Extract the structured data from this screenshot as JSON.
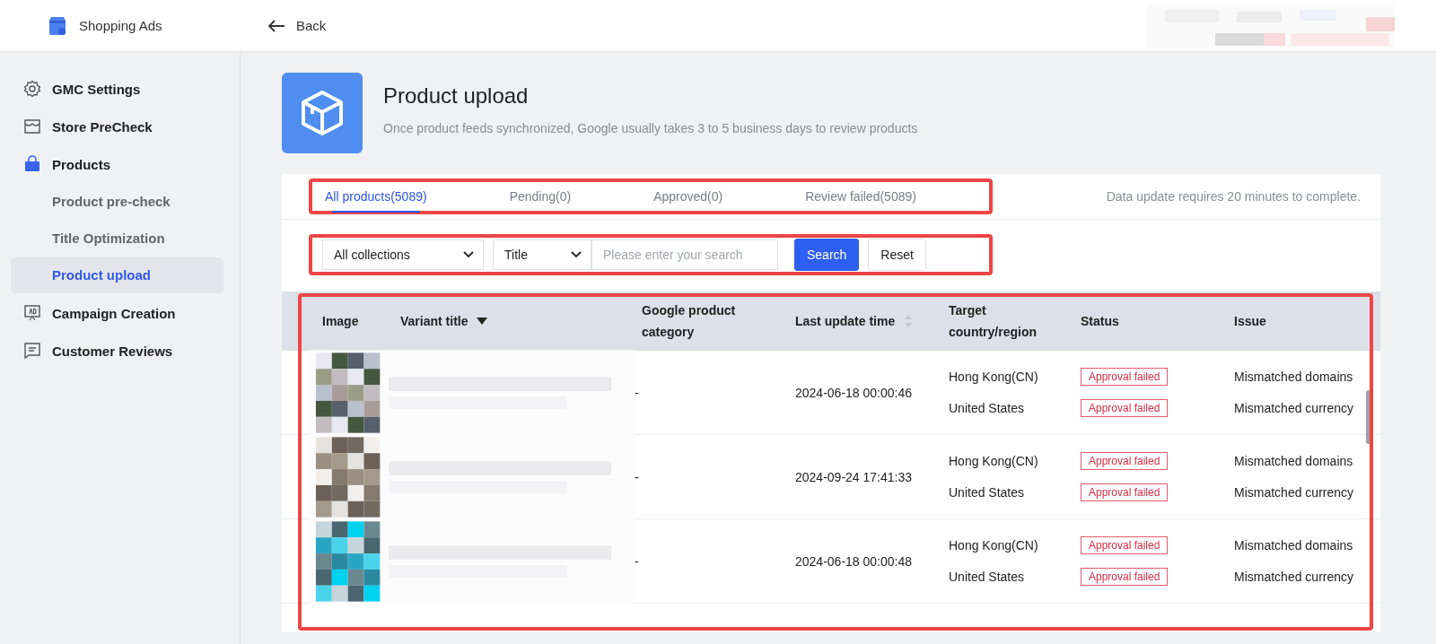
{
  "header": {
    "app_name": "Shopping Ads",
    "back_label": "Back",
    "account": {
      "kind": "picture"
    }
  },
  "sidebar": {
    "items": [
      {
        "label": "GMC Settings",
        "selected": false
      },
      {
        "label": "Store PreCheck",
        "selected": false
      },
      {
        "label": "Products",
        "selected": false,
        "children": [
          {
            "label": "Product pre-check",
            "selected": false
          },
          {
            "label": "Title Optimization",
            "selected": false
          },
          {
            "label": "Product upload",
            "selected": true
          }
        ]
      },
      {
        "label": "Campaign Creation",
        "selected": false
      },
      {
        "label": "Customer Reviews",
        "selected": false
      }
    ]
  },
  "page": {
    "title": "Product upload",
    "subtitle": "Once product feeds synchronized, Google usually takes 3 to 5 business days to review products"
  },
  "tabs": {
    "highlighted": true,
    "items": [
      {
        "label": "All products(5089)",
        "selected": true
      },
      {
        "label": "Pending(0)",
        "selected": false
      },
      {
        "label": "Approved(0)",
        "selected": false
      },
      {
        "label": "Review failed(5089)",
        "selected": false
      }
    ],
    "note": "Data update requires 20 minutes to complete."
  },
  "filters": {
    "highlighted": true,
    "collection": "All collections",
    "field": "Title",
    "search_placeholder": "Please enter your search",
    "search_button": "Search",
    "reset_button": "Reset"
  },
  "table": {
    "highlighted": true,
    "columns": [
      {
        "label": "Image",
        "kind": "plain"
      },
      {
        "label": "Variant title",
        "kind": "sorted"
      },
      {
        "label": "Google product category",
        "kind": "plain"
      },
      {
        "label": "Last update time",
        "kind": "sortable"
      },
      {
        "label": "Target country/region",
        "kind": "plain"
      },
      {
        "label": "Status",
        "kind": "plain"
      },
      {
        "label": "Issue",
        "kind": "plain"
      }
    ],
    "rows": [
      {
        "image": {
          "kind": "picture"
        },
        "category": "-",
        "updated": "2024-06-18 00:00:46",
        "targets": [
          {
            "country": "Hong Kong(CN)",
            "status": "Approval failed",
            "issue": "Mismatched domains"
          },
          {
            "country": "United States",
            "status": "Approval failed",
            "issue": "Mismatched currency"
          }
        ]
      },
      {
        "image": {
          "kind": "picture"
        },
        "category": "-",
        "updated": "2024-09-24 17:41:33",
        "targets": [
          {
            "country": "Hong Kong(CN)",
            "status": "Approval failed",
            "issue": "Mismatched domains"
          },
          {
            "country": "United States",
            "status": "Approval failed",
            "issue": "Mismatched currency"
          }
        ]
      },
      {
        "image": {
          "kind": "picture"
        },
        "category": "-",
        "updated": "2024-06-18 00:00:48",
        "targets": [
          {
            "country": "Hong Kong(CN)",
            "status": "Approval failed",
            "issue": "Mismatched domains"
          },
          {
            "country": "United States",
            "status": "Approval failed",
            "issue": "Mismatched currency"
          }
        ]
      }
    ]
  }
}
